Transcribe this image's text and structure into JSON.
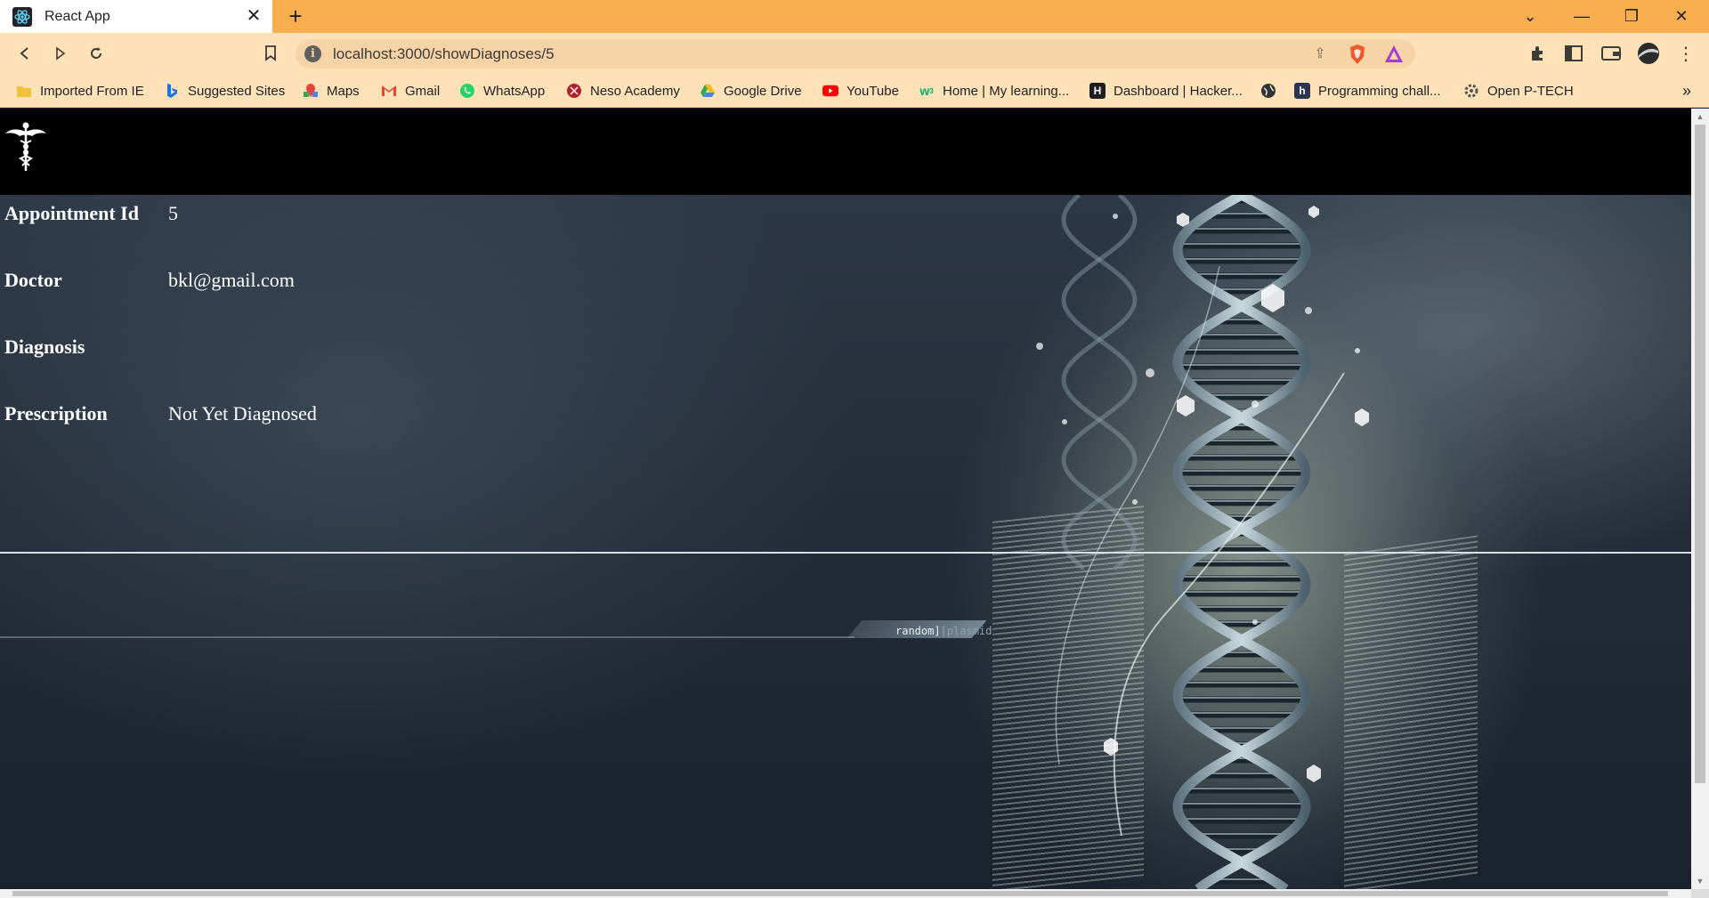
{
  "browser": {
    "tab_title": "React App",
    "url": "localhost:3000/showDiagnoses/5",
    "bookmarks": [
      {
        "label": "Imported From IE",
        "icon": "folder-icon",
        "color": "#f2c23a"
      },
      {
        "label": "Suggested Sites",
        "icon": "bing-icon",
        "color": "#1a73e8"
      },
      {
        "label": "Maps",
        "icon": "maps-icon",
        "color": "#34a853"
      },
      {
        "label": "Gmail",
        "icon": "gmail-icon",
        "color": "#ea4335"
      },
      {
        "label": "WhatsApp",
        "icon": "whatsapp-icon",
        "color": "#25d366"
      },
      {
        "label": "Neso Academy",
        "icon": "neso-icon",
        "color": "#b3202a"
      },
      {
        "label": "Google Drive",
        "icon": "drive-icon",
        "color": "#fbbc04"
      },
      {
        "label": "YouTube",
        "icon": "youtube-icon",
        "color": "#ff0000"
      },
      {
        "label": "Home | My learning...",
        "icon": "w3-icon",
        "color": "#04aa6d"
      },
      {
        "label": "Dashboard | Hacker...",
        "icon": "hackerrank-icon",
        "color": "#1e1e1e"
      },
      {
        "label": "",
        "icon": "globe-icon",
        "color": "#333333"
      },
      {
        "label": "Programming chall...",
        "icon": "hackerearth-icon",
        "color": "#2c3454"
      },
      {
        "label": "Open P-TECH",
        "icon": "ptech-icon",
        "color": "#555555"
      }
    ]
  },
  "details": {
    "rows": [
      {
        "label": "Appointment Id",
        "value": "5"
      },
      {
        "label": "Doctor",
        "value": "bkl@gmail.com"
      },
      {
        "label": "Diagnosis",
        "value": ""
      },
      {
        "label": "Prescription",
        "value": "Not Yet Diagnosed"
      }
    ]
  },
  "background": {
    "caption_a": "random]",
    "caption_b": "[plasmid"
  },
  "colors": {
    "tabbar": "#f8ad4f",
    "toolbar": "#ffe2b8",
    "header": "#000000",
    "text": "#ffffff"
  }
}
